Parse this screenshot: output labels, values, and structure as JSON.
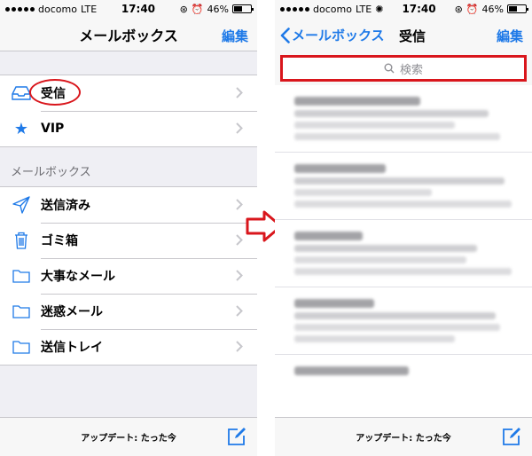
{
  "status": {
    "carrier": "docomo",
    "network": "LTE",
    "time": "17:40",
    "battery": "46%"
  },
  "left": {
    "nav": {
      "title": "メールボックス",
      "edit": "編集"
    },
    "top_items": [
      {
        "label": "受信",
        "icon": "inbox-tray-icon"
      },
      {
        "label": "VIP",
        "icon": "star-icon"
      }
    ],
    "section_title": "メールボックス",
    "mailbox_items": [
      {
        "label": "送信済み",
        "icon": "paper-plane-icon"
      },
      {
        "label": "ゴミ箱",
        "icon": "trash-icon"
      },
      {
        "label": "大事なメール",
        "icon": "folder-icon"
      },
      {
        "label": "迷惑メール",
        "icon": "folder-icon"
      },
      {
        "label": "送信トレイ",
        "icon": "folder-icon"
      }
    ],
    "toolbar": {
      "status": "アップデート: たった今"
    }
  },
  "right": {
    "nav": {
      "back": "メールボックス",
      "title": "受信",
      "edit": "編集"
    },
    "search": {
      "placeholder": "検索"
    },
    "toolbar": {
      "status": "アップデート: たった今"
    }
  },
  "colors": {
    "accent": "#1f7ae8",
    "highlight": "#d9161c"
  }
}
